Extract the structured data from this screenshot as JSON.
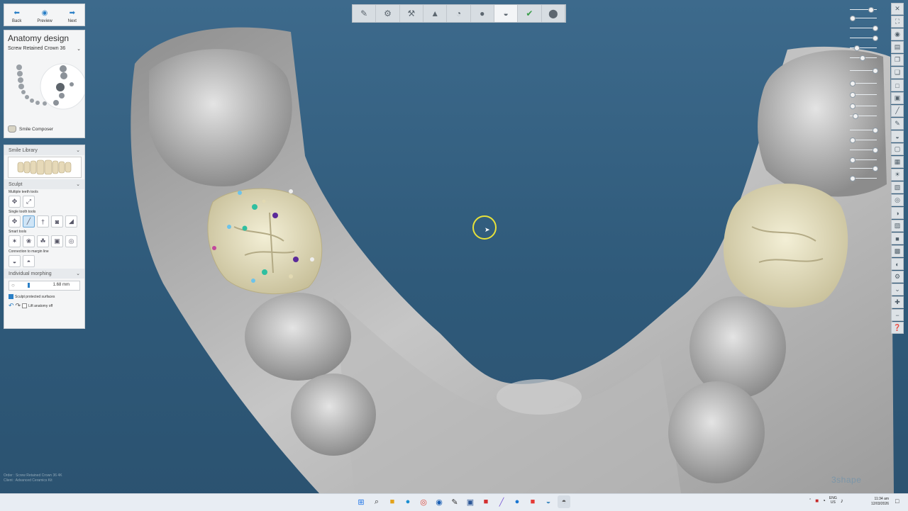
{
  "nav": {
    "back": "Back",
    "preview": "Preview",
    "next": "Next"
  },
  "design": {
    "title": "Anatomy design",
    "restoration": "Screw Retained Crown 36",
    "composer": "Smile Composer"
  },
  "library": {
    "title": "Smile Library"
  },
  "sculpt": {
    "title": "Sculpt",
    "multi": "Multiple teeth tools",
    "single": "Single tooth tools",
    "smart": "Smart tools",
    "margin": "Connection to margin line"
  },
  "morph": {
    "title": "Individual morphing",
    "value": "1.68 mm",
    "protect": "Sculpt protected surfaces",
    "lift": "Lift anatomy off"
  },
  "footer": {
    "line1": "Order : Screw Retained Crown 36 4K",
    "line2": "Client : Advanced Ceramics Kit"
  },
  "brand": "3shape",
  "tray": {
    "lang1": "ENG",
    "lang2": "US"
  },
  "clock": {
    "time": "11:34 am",
    "date": "12/03/2026"
  },
  "colors": {
    "accent": "#2a7fc6",
    "cursor": "#e8e23a",
    "crown": "#e9e3c4",
    "model": "#a9a9a9"
  }
}
